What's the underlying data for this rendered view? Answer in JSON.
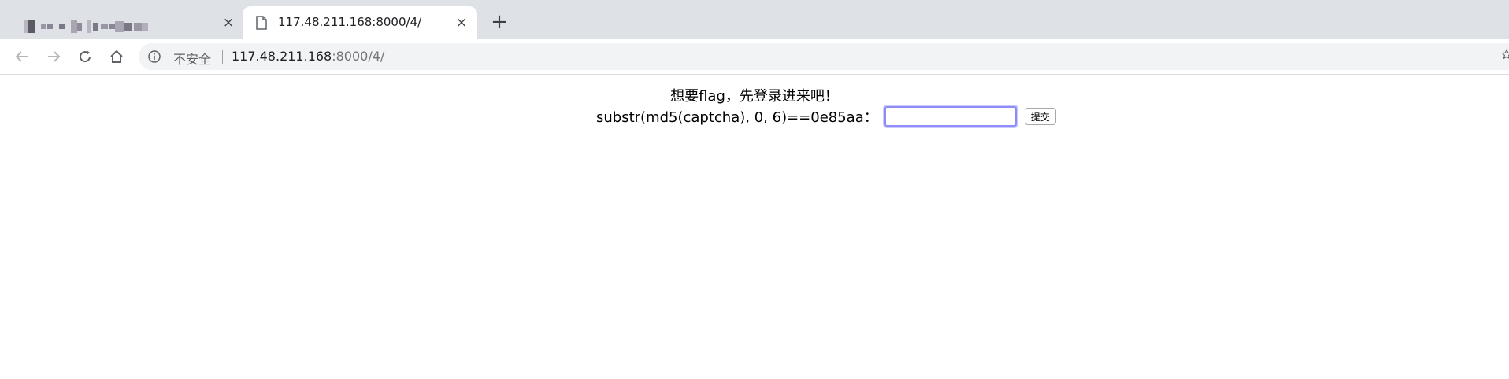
{
  "tabs": [
    {
      "title": "",
      "active": false,
      "close_glyph": "×"
    },
    {
      "title": "117.48.211.168:8000/4/",
      "active": true,
      "close_glyph": "×",
      "favicon": "page-icon"
    }
  ],
  "new_tab_glyph": "+",
  "toolbar": {
    "back_icon": "arrow-left-icon",
    "forward_icon": "arrow-right-icon",
    "reload_icon": "reload-icon",
    "home_icon": "home-icon",
    "security_icon": "info-icon",
    "security_label": "不安全",
    "url_host": "117.48.211.168",
    "url_rest": ":8000/4/",
    "bookmark_icon": "star-icon"
  },
  "page": {
    "heading": "想要flag，先登录进来吧！",
    "form_label": "substr(md5(captcha), 0, 6)==0e85aa：",
    "input_value": "",
    "submit_label": "提交"
  },
  "colors": {
    "tab_strip": "#dee1e6",
    "omnibox": "#f1f3f4",
    "input_focus": "#8d8df5"
  }
}
